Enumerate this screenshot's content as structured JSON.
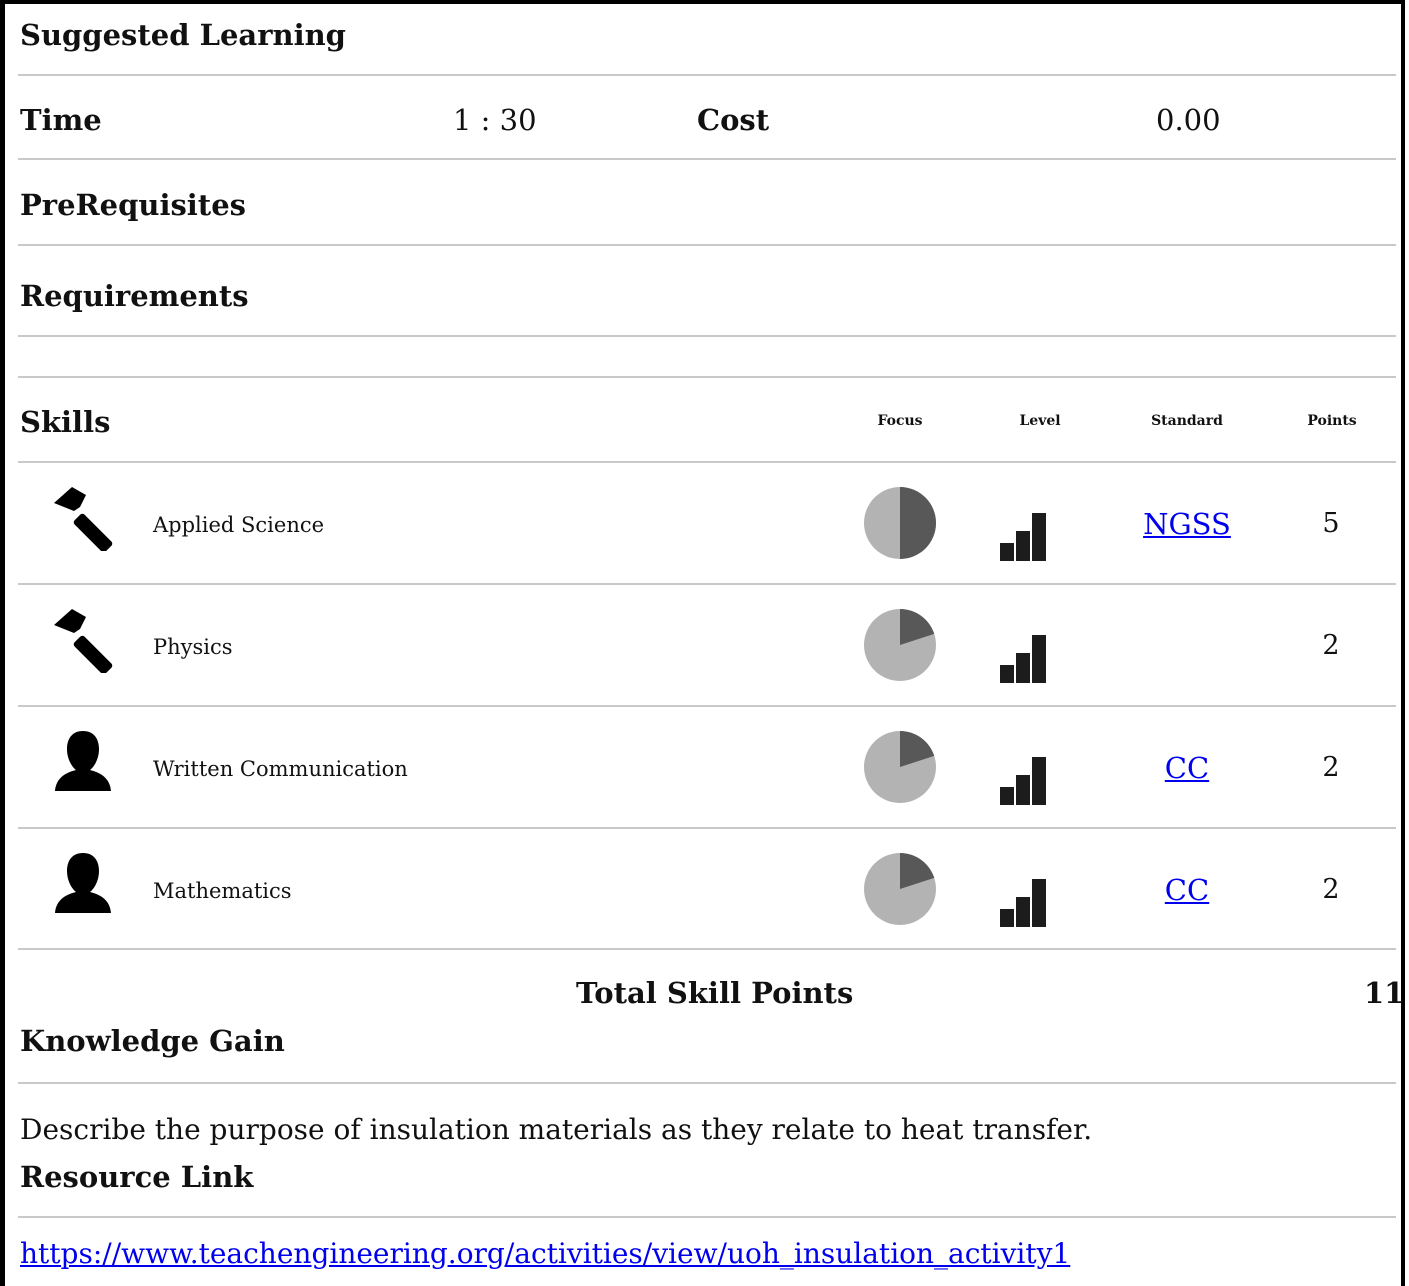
{
  "title": "Suggested Learning",
  "time": {
    "label": "Time",
    "value": "1 : 30"
  },
  "cost": {
    "label": "Cost",
    "value": "0.00"
  },
  "prerequisites_label": "PreRequisites",
  "requirements_label": "Requirements",
  "skills": {
    "label": "Skills",
    "columns": {
      "focus": "Focus",
      "level": "Level",
      "standard": "Standard",
      "points": "Points"
    },
    "rows": [
      {
        "icon": "hammer-icon",
        "name": "Applied Science",
        "focus": 0.5,
        "level": "3 of 3 bars",
        "standard": "NGSS",
        "points": "5"
      },
      {
        "icon": "hammer-icon",
        "name": "Physics",
        "focus": 0.2,
        "level": "3 of 3 bars",
        "standard": "",
        "points": "2"
      },
      {
        "icon": "person-icon",
        "name": "Written Communication",
        "focus": 0.2,
        "level": "3 of 3 bars",
        "standard": "CC",
        "points": "2"
      },
      {
        "icon": "person-icon",
        "name": "Mathematics",
        "focus": 0.2,
        "level": "3 of 3 bars",
        "standard": "CC",
        "points": "2"
      }
    ]
  },
  "total": {
    "label": "Total Skill Points",
    "value": "11"
  },
  "knowledge": {
    "label": "Knowledge Gain",
    "text": "Describe the purpose of insulation materials as they relate to heat transfer."
  },
  "resource": {
    "label": "Resource Link",
    "url": "https://www.teachengineering.org/activities/view/uoh_insulation_activity1"
  },
  "colors": {
    "pie_dark": "#585858",
    "pie_light": "#b3b3b3",
    "bars": "#1c1c1c",
    "link": "#0000ee"
  }
}
